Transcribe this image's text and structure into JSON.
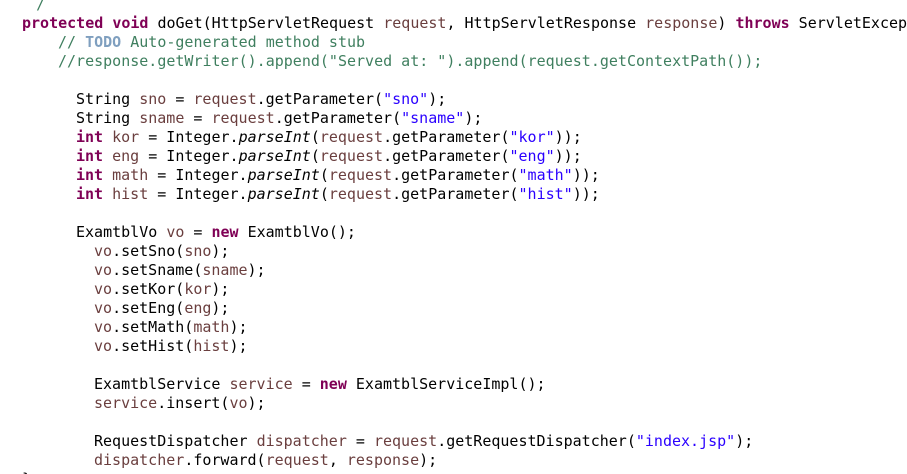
{
  "editor": {
    "lines": [
      {
        "indent": 0,
        "tokens": [
          {
            "t": "    /",
            "k": "comment"
          }
        ]
      },
      {
        "indent": 0,
        "tokens": [
          {
            "t": "protected",
            "k": "keyword"
          },
          {
            "t": " ",
            "k": "plain"
          },
          {
            "t": "void",
            "k": "keyword"
          },
          {
            "t": " doGet(HttpServletRequest ",
            "k": "plain"
          },
          {
            "t": "request",
            "k": "var"
          },
          {
            "t": ", HttpServletResponse ",
            "k": "plain"
          },
          {
            "t": "response",
            "k": "var"
          },
          {
            "t": ") ",
            "k": "plain"
          },
          {
            "t": "throws",
            "k": "keyword"
          },
          {
            "t": " ServletExcept",
            "k": "plain"
          }
        ]
      },
      {
        "indent": 1,
        "tokens": [
          {
            "t": "// ",
            "k": "comment"
          },
          {
            "t": "TODO",
            "k": "todo"
          },
          {
            "t": " Auto-generated method stub",
            "k": "comment"
          }
        ]
      },
      {
        "indent": 1,
        "tokens": [
          {
            "t": "//response.getWriter().append(\"Served at: \").append(request.getContextPath());",
            "k": "comment"
          }
        ]
      },
      {
        "indent": 0,
        "tokens": []
      },
      {
        "indent": 2,
        "tokens": [
          {
            "t": "String ",
            "k": "plain"
          },
          {
            "t": "sno",
            "k": "var"
          },
          {
            "t": " = ",
            "k": "plain"
          },
          {
            "t": "request",
            "k": "var"
          },
          {
            "t": ".getParameter(",
            "k": "plain"
          },
          {
            "t": "\"sno\"",
            "k": "string"
          },
          {
            "t": ");",
            "k": "plain"
          }
        ]
      },
      {
        "indent": 2,
        "tokens": [
          {
            "t": "String ",
            "k": "plain"
          },
          {
            "t": "sname",
            "k": "var"
          },
          {
            "t": " = ",
            "k": "plain"
          },
          {
            "t": "request",
            "k": "var"
          },
          {
            "t": ".getParameter(",
            "k": "plain"
          },
          {
            "t": "\"sname\"",
            "k": "string"
          },
          {
            "t": ");",
            "k": "plain"
          }
        ]
      },
      {
        "indent": 2,
        "tokens": [
          {
            "t": "int",
            "k": "keyword"
          },
          {
            "t": " ",
            "k": "plain"
          },
          {
            "t": "kor",
            "k": "var"
          },
          {
            "t": " = Integer.",
            "k": "plain"
          },
          {
            "t": "parseInt",
            "k": "static"
          },
          {
            "t": "(",
            "k": "plain"
          },
          {
            "t": "request",
            "k": "var"
          },
          {
            "t": ".getParameter(",
            "k": "plain"
          },
          {
            "t": "\"kor\"",
            "k": "string"
          },
          {
            "t": "));",
            "k": "plain"
          }
        ]
      },
      {
        "indent": 2,
        "tokens": [
          {
            "t": "int",
            "k": "keyword"
          },
          {
            "t": " ",
            "k": "plain"
          },
          {
            "t": "eng",
            "k": "var"
          },
          {
            "t": " = Integer.",
            "k": "plain"
          },
          {
            "t": "parseInt",
            "k": "static"
          },
          {
            "t": "(",
            "k": "plain"
          },
          {
            "t": "request",
            "k": "var"
          },
          {
            "t": ".getParameter(",
            "k": "plain"
          },
          {
            "t": "\"eng\"",
            "k": "string"
          },
          {
            "t": "));",
            "k": "plain"
          }
        ]
      },
      {
        "indent": 2,
        "tokens": [
          {
            "t": "int",
            "k": "keyword"
          },
          {
            "t": " ",
            "k": "plain"
          },
          {
            "t": "math",
            "k": "var"
          },
          {
            "t": " = Integer.",
            "k": "plain"
          },
          {
            "t": "parseInt",
            "k": "static"
          },
          {
            "t": "(",
            "k": "plain"
          },
          {
            "t": "request",
            "k": "var"
          },
          {
            "t": ".getParameter(",
            "k": "plain"
          },
          {
            "t": "\"math\"",
            "k": "string"
          },
          {
            "t": "));",
            "k": "plain"
          }
        ]
      },
      {
        "indent": 2,
        "tokens": [
          {
            "t": "int",
            "k": "keyword"
          },
          {
            "t": " ",
            "k": "plain"
          },
          {
            "t": "hist",
            "k": "var"
          },
          {
            "t": " = Integer.",
            "k": "plain"
          },
          {
            "t": "parseInt",
            "k": "static"
          },
          {
            "t": "(",
            "k": "plain"
          },
          {
            "t": "request",
            "k": "var"
          },
          {
            "t": ".getParameter(",
            "k": "plain"
          },
          {
            "t": "\"hist\"",
            "k": "string"
          },
          {
            "t": "));",
            "k": "plain"
          }
        ]
      },
      {
        "indent": 0,
        "tokens": []
      },
      {
        "indent": 2,
        "tokens": [
          {
            "t": "ExamtblVo ",
            "k": "plain"
          },
          {
            "t": "vo",
            "k": "var"
          },
          {
            "t": " = ",
            "k": "plain"
          },
          {
            "t": "new",
            "k": "keyword"
          },
          {
            "t": " ExamtblVo();",
            "k": "plain"
          }
        ]
      },
      {
        "indent": 3,
        "tokens": [
          {
            "t": "vo",
            "k": "var"
          },
          {
            "t": ".setSno(",
            "k": "plain"
          },
          {
            "t": "sno",
            "k": "var"
          },
          {
            "t": ");",
            "k": "plain"
          }
        ]
      },
      {
        "indent": 3,
        "tokens": [
          {
            "t": "vo",
            "k": "var"
          },
          {
            "t": ".setSname(",
            "k": "plain"
          },
          {
            "t": "sname",
            "k": "var"
          },
          {
            "t": ");",
            "k": "plain"
          }
        ]
      },
      {
        "indent": 3,
        "tokens": [
          {
            "t": "vo",
            "k": "var"
          },
          {
            "t": ".setKor(",
            "k": "plain"
          },
          {
            "t": "kor",
            "k": "var"
          },
          {
            "t": ");",
            "k": "plain"
          }
        ]
      },
      {
        "indent": 3,
        "tokens": [
          {
            "t": "vo",
            "k": "var"
          },
          {
            "t": ".setEng(",
            "k": "plain"
          },
          {
            "t": "eng",
            "k": "var"
          },
          {
            "t": ");",
            "k": "plain"
          }
        ]
      },
      {
        "indent": 3,
        "tokens": [
          {
            "t": "vo",
            "k": "var"
          },
          {
            "t": ".setMath(",
            "k": "plain"
          },
          {
            "t": "math",
            "k": "var"
          },
          {
            "t": ");",
            "k": "plain"
          }
        ]
      },
      {
        "indent": 3,
        "tokens": [
          {
            "t": "vo",
            "k": "var"
          },
          {
            "t": ".setHist(",
            "k": "plain"
          },
          {
            "t": "hist",
            "k": "var"
          },
          {
            "t": ");",
            "k": "plain"
          }
        ]
      },
      {
        "indent": 0,
        "tokens": []
      },
      {
        "indent": 3,
        "tokens": [
          {
            "t": "ExamtblService ",
            "k": "plain"
          },
          {
            "t": "service",
            "k": "var"
          },
          {
            "t": " = ",
            "k": "plain"
          },
          {
            "t": "new",
            "k": "keyword"
          },
          {
            "t": " ExamtblServiceImpl();",
            "k": "plain"
          }
        ]
      },
      {
        "indent": 3,
        "tokens": [
          {
            "t": "service",
            "k": "var"
          },
          {
            "t": ".insert(",
            "k": "plain"
          },
          {
            "t": "vo",
            "k": "var"
          },
          {
            "t": ");",
            "k": "plain"
          }
        ]
      },
      {
        "indent": 0,
        "tokens": []
      },
      {
        "indent": 3,
        "tokens": [
          {
            "t": "RequestDispatcher ",
            "k": "plain"
          },
          {
            "t": "dispatcher",
            "k": "var"
          },
          {
            "t": " = ",
            "k": "plain"
          },
          {
            "t": "request",
            "k": "var"
          },
          {
            "t": ".getRequestDispatcher(",
            "k": "plain"
          },
          {
            "t": "\"index.jsp\"",
            "k": "string"
          },
          {
            "t": ");",
            "k": "plain"
          }
        ]
      },
      {
        "indent": 3,
        "tokens": [
          {
            "t": "dispatcher",
            "k": "var"
          },
          {
            "t": ".forward(",
            "k": "plain"
          },
          {
            "t": "request",
            "k": "var"
          },
          {
            "t": ", ",
            "k": "plain"
          },
          {
            "t": "response",
            "k": "var"
          },
          {
            "t": ");",
            "k": "plain"
          }
        ]
      },
      {
        "indent": 0,
        "tokens": [
          {
            "t": "}",
            "k": "plain"
          }
        ]
      }
    ]
  }
}
